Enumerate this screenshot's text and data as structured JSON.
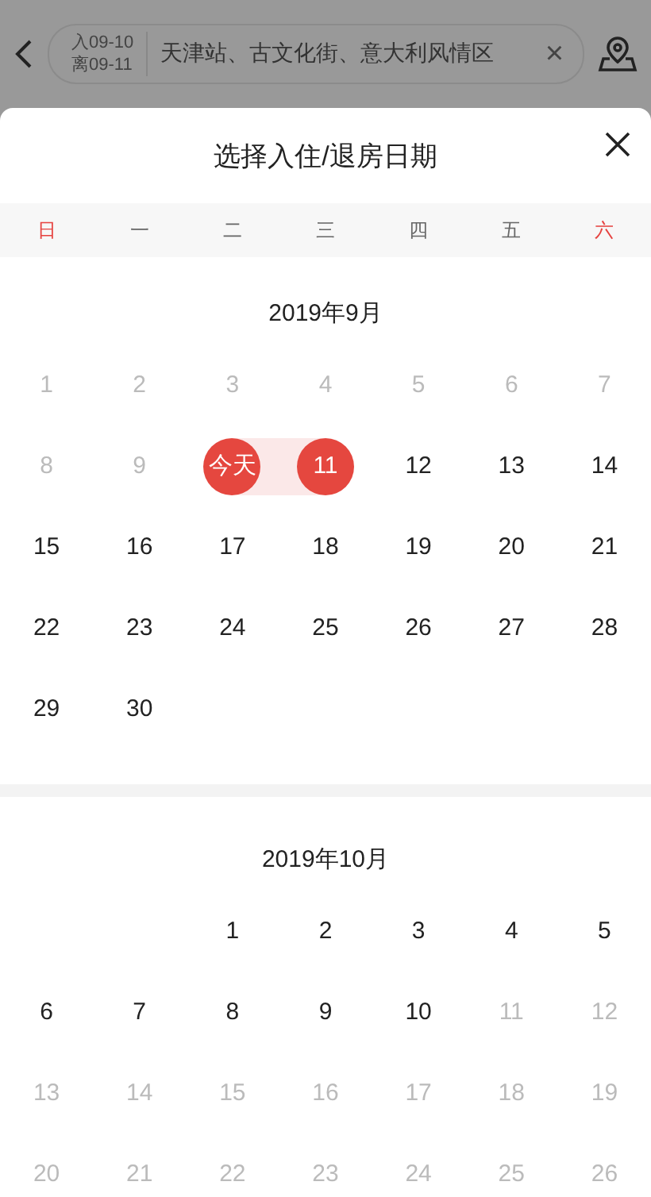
{
  "top_bar": {
    "checkin": "入09-10",
    "checkout": "离09-11",
    "location": "天津站、古文化街、意大利风情区",
    "clear": "×"
  },
  "sheet": {
    "title": "选择入住/退房日期",
    "weekdays": [
      {
        "label": "日",
        "weekend": true
      },
      {
        "label": "一",
        "weekend": false
      },
      {
        "label": "二",
        "weekend": false
      },
      {
        "label": "三",
        "weekend": false
      },
      {
        "label": "四",
        "weekend": false
      },
      {
        "label": "五",
        "weekend": false
      },
      {
        "label": "六",
        "weekend": true
      }
    ],
    "months": [
      {
        "title": "2019年9月",
        "weeks": [
          [
            {
              "kind": "day",
              "label": "1",
              "disabled": true,
              "selected": false,
              "range_start": false,
              "range_end": false
            },
            {
              "kind": "day",
              "label": "2",
              "disabled": true,
              "selected": false,
              "range_start": false,
              "range_end": false
            },
            {
              "kind": "day",
              "label": "3",
              "disabled": true,
              "selected": false,
              "range_start": false,
              "range_end": false
            },
            {
              "kind": "day",
              "label": "4",
              "disabled": true,
              "selected": false,
              "range_start": false,
              "range_end": false
            },
            {
              "kind": "day",
              "label": "5",
              "disabled": true,
              "selected": false,
              "range_start": false,
              "range_end": false
            },
            {
              "kind": "day",
              "label": "6",
              "disabled": true,
              "selected": false,
              "range_start": false,
              "range_end": false
            },
            {
              "kind": "day",
              "label": "7",
              "disabled": true,
              "selected": false,
              "range_start": false,
              "range_end": false
            }
          ],
          [
            {
              "kind": "day",
              "label": "8",
              "disabled": true,
              "selected": false,
              "range_start": false,
              "range_end": false
            },
            {
              "kind": "day",
              "label": "9",
              "disabled": true,
              "selected": false,
              "range_start": false,
              "range_end": false
            },
            {
              "kind": "day",
              "label": "今天",
              "disabled": false,
              "selected": true,
              "range_start": true,
              "range_end": false
            },
            {
              "kind": "day",
              "label": "11",
              "disabled": false,
              "selected": true,
              "range_start": false,
              "range_end": true
            },
            {
              "kind": "day",
              "label": "12",
              "disabled": false,
              "selected": false,
              "range_start": false,
              "range_end": false
            },
            {
              "kind": "day",
              "label": "13",
              "disabled": false,
              "selected": false,
              "range_start": false,
              "range_end": false
            },
            {
              "kind": "day",
              "label": "14",
              "disabled": false,
              "selected": false,
              "range_start": false,
              "range_end": false
            }
          ],
          [
            {
              "kind": "day",
              "label": "15",
              "disabled": false,
              "selected": false,
              "range_start": false,
              "range_end": false
            },
            {
              "kind": "day",
              "label": "16",
              "disabled": false,
              "selected": false,
              "range_start": false,
              "range_end": false
            },
            {
              "kind": "day",
              "label": "17",
              "disabled": false,
              "selected": false,
              "range_start": false,
              "range_end": false
            },
            {
              "kind": "day",
              "label": "18",
              "disabled": false,
              "selected": false,
              "range_start": false,
              "range_end": false
            },
            {
              "kind": "day",
              "label": "19",
              "disabled": false,
              "selected": false,
              "range_start": false,
              "range_end": false
            },
            {
              "kind": "day",
              "label": "20",
              "disabled": false,
              "selected": false,
              "range_start": false,
              "range_end": false
            },
            {
              "kind": "day",
              "label": "21",
              "disabled": false,
              "selected": false,
              "range_start": false,
              "range_end": false
            }
          ],
          [
            {
              "kind": "day",
              "label": "22",
              "disabled": false,
              "selected": false,
              "range_start": false,
              "range_end": false
            },
            {
              "kind": "day",
              "label": "23",
              "disabled": false,
              "selected": false,
              "range_start": false,
              "range_end": false
            },
            {
              "kind": "day",
              "label": "24",
              "disabled": false,
              "selected": false,
              "range_start": false,
              "range_end": false
            },
            {
              "kind": "day",
              "label": "25",
              "disabled": false,
              "selected": false,
              "range_start": false,
              "range_end": false
            },
            {
              "kind": "day",
              "label": "26",
              "disabled": false,
              "selected": false,
              "range_start": false,
              "range_end": false
            },
            {
              "kind": "day",
              "label": "27",
              "disabled": false,
              "selected": false,
              "range_start": false,
              "range_end": false
            },
            {
              "kind": "day",
              "label": "28",
              "disabled": false,
              "selected": false,
              "range_start": false,
              "range_end": false
            }
          ],
          [
            {
              "kind": "day",
              "label": "29",
              "disabled": false,
              "selected": false,
              "range_start": false,
              "range_end": false
            },
            {
              "kind": "day",
              "label": "30",
              "disabled": false,
              "selected": false,
              "range_start": false,
              "range_end": false
            }
          ]
        ]
      },
      {
        "title": "2019年10月",
        "weeks": [
          [
            {
              "kind": "blank"
            },
            {
              "kind": "blank"
            },
            {
              "kind": "day",
              "label": "1",
              "disabled": false,
              "selected": false,
              "range_start": false,
              "range_end": false
            },
            {
              "kind": "day",
              "label": "2",
              "disabled": false,
              "selected": false,
              "range_start": false,
              "range_end": false
            },
            {
              "kind": "day",
              "label": "3",
              "disabled": false,
              "selected": false,
              "range_start": false,
              "range_end": false
            },
            {
              "kind": "day",
              "label": "4",
              "disabled": false,
              "selected": false,
              "range_start": false,
              "range_end": false
            },
            {
              "kind": "day",
              "label": "5",
              "disabled": false,
              "selected": false,
              "range_start": false,
              "range_end": false
            }
          ],
          [
            {
              "kind": "day",
              "label": "6",
              "disabled": false,
              "selected": false,
              "range_start": false,
              "range_end": false
            },
            {
              "kind": "day",
              "label": "7",
              "disabled": false,
              "selected": false,
              "range_start": false,
              "range_end": false
            },
            {
              "kind": "day",
              "label": "8",
              "disabled": false,
              "selected": false,
              "range_start": false,
              "range_end": false
            },
            {
              "kind": "day",
              "label": "9",
              "disabled": false,
              "selected": false,
              "range_start": false,
              "range_end": false
            },
            {
              "kind": "day",
              "label": "10",
              "disabled": false,
              "selected": false,
              "range_start": false,
              "range_end": false
            },
            {
              "kind": "day",
              "label": "11",
              "disabled": true,
              "selected": false,
              "range_start": false,
              "range_end": false
            },
            {
              "kind": "day",
              "label": "12",
              "disabled": true,
              "selected": false,
              "range_start": false,
              "range_end": false
            }
          ],
          [
            {
              "kind": "day",
              "label": "13",
              "disabled": true,
              "selected": false,
              "range_start": false,
              "range_end": false
            },
            {
              "kind": "day",
              "label": "14",
              "disabled": true,
              "selected": false,
              "range_start": false,
              "range_end": false
            },
            {
              "kind": "day",
              "label": "15",
              "disabled": true,
              "selected": false,
              "range_start": false,
              "range_end": false
            },
            {
              "kind": "day",
              "label": "16",
              "disabled": true,
              "selected": false,
              "range_start": false,
              "range_end": false
            },
            {
              "kind": "day",
              "label": "17",
              "disabled": true,
              "selected": false,
              "range_start": false,
              "range_end": false
            },
            {
              "kind": "day",
              "label": "18",
              "disabled": true,
              "selected": false,
              "range_start": false,
              "range_end": false
            },
            {
              "kind": "day",
              "label": "19",
              "disabled": true,
              "selected": false,
              "range_start": false,
              "range_end": false
            }
          ],
          [
            {
              "kind": "day",
              "label": "20",
              "disabled": true,
              "selected": false,
              "range_start": false,
              "range_end": false
            },
            {
              "kind": "day",
              "label": "21",
              "disabled": true,
              "selected": false,
              "range_start": false,
              "range_end": false
            },
            {
              "kind": "day",
              "label": "22",
              "disabled": true,
              "selected": false,
              "range_start": false,
              "range_end": false
            },
            {
              "kind": "day",
              "label": "23",
              "disabled": true,
              "selected": false,
              "range_start": false,
              "range_end": false
            },
            {
              "kind": "day",
              "label": "24",
              "disabled": true,
              "selected": false,
              "range_start": false,
              "range_end": false
            },
            {
              "kind": "day",
              "label": "25",
              "disabled": true,
              "selected": false,
              "range_start": false,
              "range_end": false
            },
            {
              "kind": "day",
              "label": "26",
              "disabled": true,
              "selected": false,
              "range_start": false,
              "range_end": false
            }
          ]
        ]
      }
    ]
  }
}
